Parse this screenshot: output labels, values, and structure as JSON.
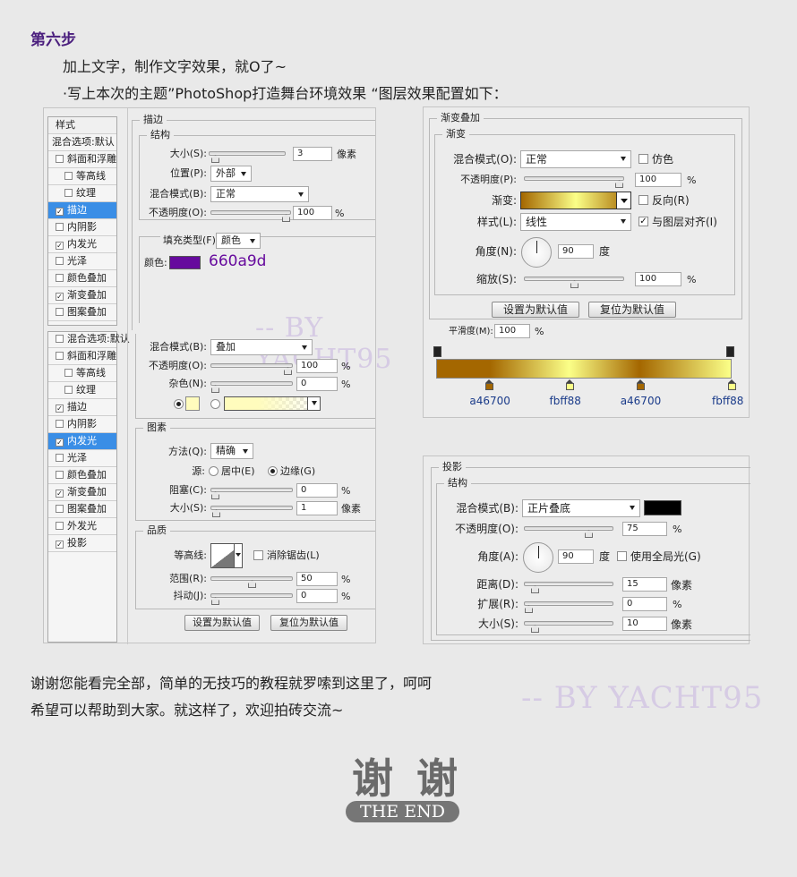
{
  "article": {
    "step_title": "第六步",
    "line1": "加上文字，制作文字效果，就O了~",
    "line2": "·写上本次的主题”PhotoShop打造舞台环境效果 “图层效果配置如下：",
    "footer1": "谢谢您能看完全部，简单的无技巧的教程就罗嗦到这里了，呵呵",
    "footer2": "希望可以帮助到大家。就这样了，欢迎拍砖交流~",
    "watermark1": "-- BY YACHT95",
    "watermark2": "-- BY YACHT95",
    "end_big": "谢  谢",
    "end_small": "THE END"
  },
  "colors": {
    "step_title": "#4b1f7e",
    "stroke_swatch": "#660a9d",
    "gradient_dark": "#a46700",
    "gradient_light": "#fbff88",
    "glow_swatch": "#fffcbd"
  },
  "layer_list_1": {
    "header": "样式",
    "items": [
      {
        "label": "混合选项:默认",
        "checked": false,
        "indent": false
      },
      {
        "label": "斜面和浮雕",
        "checked": false,
        "indent": false
      },
      {
        "label": "等高线",
        "checked": false,
        "indent": true
      },
      {
        "label": "纹理",
        "checked": false,
        "indent": true
      },
      {
        "label": "描边",
        "checked": true,
        "indent": false,
        "selected": true
      },
      {
        "label": "内阴影",
        "checked": false,
        "indent": false
      },
      {
        "label": "内发光",
        "checked": true,
        "indent": false
      },
      {
        "label": "光泽",
        "checked": false,
        "indent": false
      },
      {
        "label": "颜色叠加",
        "checked": false,
        "indent": false
      },
      {
        "label": "渐变叠加",
        "checked": true,
        "indent": false
      },
      {
        "label": "图案叠加",
        "checked": false,
        "indent": false
      }
    ]
  },
  "layer_list_2": {
    "items": [
      {
        "label": "混合选项:默认",
        "checked": false,
        "indent": false
      },
      {
        "label": "斜面和浮雕",
        "checked": false,
        "indent": false
      },
      {
        "label": "等高线",
        "checked": false,
        "indent": true
      },
      {
        "label": "纹理",
        "checked": false,
        "indent": true
      },
      {
        "label": "描边",
        "checked": true,
        "indent": false
      },
      {
        "label": "内阴影",
        "checked": false,
        "indent": false
      },
      {
        "label": "内发光",
        "checked": true,
        "indent": false,
        "selected": true
      },
      {
        "label": "光泽",
        "checked": false,
        "indent": false
      },
      {
        "label": "颜色叠加",
        "checked": false,
        "indent": false
      },
      {
        "label": "渐变叠加",
        "checked": true,
        "indent": false
      },
      {
        "label": "图案叠加",
        "checked": false,
        "indent": false
      },
      {
        "label": "外发光",
        "checked": false,
        "indent": false
      },
      {
        "label": "投影",
        "checked": true,
        "indent": false
      }
    ]
  },
  "stroke": {
    "title": "描边",
    "structure": "结构",
    "size_label": "大小(S):",
    "size_value": "3",
    "size_unit": "像素",
    "size_level": 0.02,
    "position_label": "位置(P):",
    "position_value": "外部",
    "blend_label": "混合模式(B):",
    "blend_value": "正常",
    "opacity_label": "不透明度(O):",
    "opacity_value": "100",
    "opacity_unit": "%",
    "opacity_level": 1.0,
    "fill_label": "填充类型(F):",
    "fill_value": "颜色",
    "color_label": "颜色:",
    "color_hex": "660a9d"
  },
  "inner_glow": {
    "blend_label": "混合模式(B):",
    "blend_value": "叠加",
    "opacity_label": "不透明度(O):",
    "opacity_value": "100",
    "opacity_unit": "%",
    "opacity_level": 1.0,
    "noise_label": "杂色(N):",
    "noise_value": "0",
    "noise_unit": "%",
    "noise_level": 0.0,
    "elements_title": "图素",
    "method_label": "方法(Q):",
    "method_value": "精确",
    "source_label": "源:",
    "source_center": "居中(E)",
    "source_edge": "边缘(G)",
    "choke_label": "阻塞(C):",
    "choke_value": "0",
    "choke_unit": "%",
    "choke_level": 0.0,
    "size_label": "大小(S):",
    "size_value": "1",
    "size_unit": "像素",
    "size_level": 0.01,
    "quality_title": "品质",
    "contour_label": "等高线:",
    "antialias_label": "消除锯齿(L)",
    "range_label": "范围(R):",
    "range_value": "50",
    "range_unit": "%",
    "range_level": 0.5,
    "jitter_label": "抖动(J):",
    "jitter_value": "0",
    "jitter_unit": "%",
    "jitter_level": 0.0,
    "btn_set_default": "设置为默认值",
    "btn_reset_default": "复位为默认值"
  },
  "gradient_overlay": {
    "title": "渐变叠加",
    "sub": "渐变",
    "blend_label": "混合模式(O):",
    "blend_value": "正常",
    "dither_label": "仿色",
    "opacity_label": "不透明度(P):",
    "opacity_value": "100",
    "opacity_unit": "%",
    "opacity_level": 1.0,
    "gradient_label": "渐变:",
    "reverse_label": "反向(R)",
    "style_label": "样式(L):",
    "style_value": "线性",
    "align_label": "与图层对齐(I)",
    "angle_label": "角度(N):",
    "angle_value": "90",
    "angle_unit": "度",
    "scale_label": "缩放(S):",
    "scale_value": "100",
    "scale_unit": "%",
    "scale_level": 0.5,
    "btn_set_default": "设置为默认值",
    "btn_reset_default": "复位为默认值",
    "smooth_label": "平滑度(M):",
    "smooth_value": "100",
    "smooth_unit": "%",
    "stops": [
      {
        "label": "a46700",
        "color": "#a46700",
        "location": 0.18
      },
      {
        "label": "fbff88",
        "color": "#fbff88",
        "location": 0.45
      },
      {
        "label": "a46700",
        "color": "#a46700",
        "location": 0.69
      },
      {
        "label": "fbff88",
        "color": "#fbff88",
        "location": 1.0
      }
    ]
  },
  "drop_shadow": {
    "title": "投影",
    "structure": "结构",
    "blend_label": "混合模式(B):",
    "blend_value": "正片叠底",
    "swatch": "#000000",
    "opacity_label": "不透明度(O):",
    "opacity_value": "75",
    "opacity_unit": "%",
    "opacity_level": 0.75,
    "angle_label": "角度(A):",
    "angle_value": "90",
    "angle_unit": "度",
    "global_label": "使用全局光(G)",
    "distance_label": "距离(D):",
    "distance_value": "15",
    "distance_unit": "像素",
    "distance_level": 0.08,
    "spread_label": "扩展(R):",
    "spread_value": "0",
    "spread_unit": "%",
    "spread_level": 0.0,
    "size_label": "大小(S):",
    "size_value": "10",
    "size_unit": "像素",
    "size_level": 0.08
  }
}
